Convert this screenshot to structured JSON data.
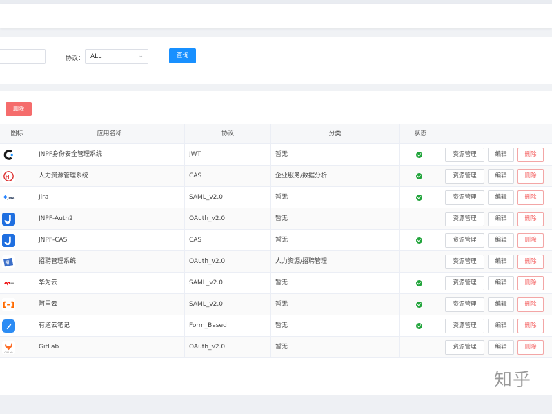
{
  "filters": {
    "protocol_label": "协议：",
    "protocol_value": "ALL",
    "query_label": "查询"
  },
  "toolbar": {
    "delete_label": "删除"
  },
  "table": {
    "headers": {
      "icon": "图标",
      "name": "应用名称",
      "protocol": "协议",
      "category": "分类",
      "status": "状态",
      "scroll_hint": ""
    },
    "actions": {
      "resource": "资源管理",
      "edit": "编辑",
      "delete": "删除"
    },
    "rows": [
      {
        "icon": "jnpf-c-icon",
        "name": "JNPF身份安全管理系统",
        "protocol": "JWT",
        "category": "暂无",
        "enabled": true
      },
      {
        "icon": "hr-icon",
        "name": "人力资源管理系统",
        "protocol": "CAS",
        "category": "企业服务/数据分析",
        "enabled": true
      },
      {
        "icon": "jira-icon",
        "name": "Jira",
        "protocol": "SAML_v2.0",
        "category": "暂无",
        "enabled": true
      },
      {
        "icon": "jnpf-j-icon",
        "name": "JNPF-Auth2",
        "protocol": "OAuth_v2.0",
        "category": "暂无",
        "enabled": false
      },
      {
        "icon": "jnpf-j-icon",
        "name": "JNPF-CAS",
        "protocol": "CAS",
        "category": "暂无",
        "enabled": true
      },
      {
        "icon": "recruit-icon",
        "name": "招聘管理系统",
        "protocol": "OAuth_v2.0",
        "category": "人力资源/招聘管理",
        "enabled": false
      },
      {
        "icon": "huawei-cloud-icon",
        "name": "华为云",
        "protocol": "SAML_v2.0",
        "category": "暂无",
        "enabled": true
      },
      {
        "icon": "aliyun-icon",
        "name": "阿里云",
        "protocol": "SAML_v2.0",
        "category": "暂无",
        "enabled": true
      },
      {
        "icon": "youdao-note-icon",
        "name": "有道云笔记",
        "protocol": "Form_Based",
        "category": "暂无",
        "enabled": true
      },
      {
        "icon": "gitlab-icon",
        "name": "GitLab",
        "protocol": "OAuth_v2.0",
        "category": "暂无",
        "enabled": false
      }
    ]
  },
  "watermark": "知乎",
  "colors": {
    "primary": "#1890ff",
    "danger": "#f56c6c",
    "success": "#21a43b"
  }
}
